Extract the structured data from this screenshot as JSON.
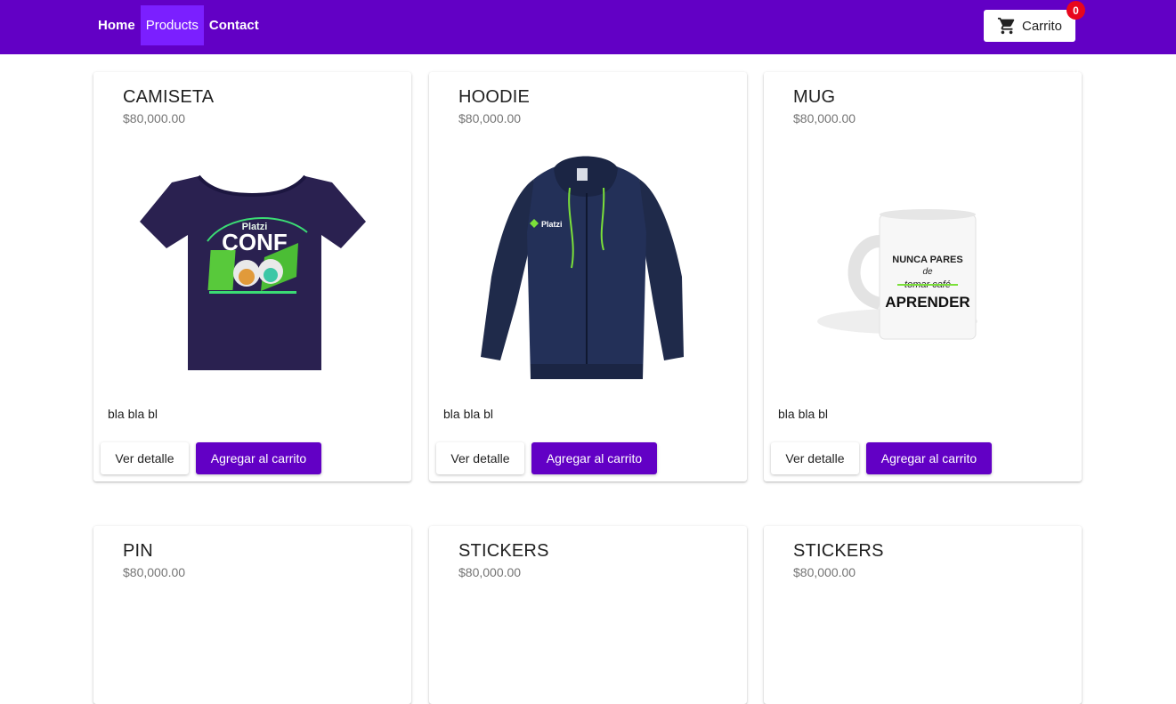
{
  "nav": {
    "items": [
      {
        "label": "Home"
      },
      {
        "label": "Products"
      },
      {
        "label": "Contact"
      }
    ],
    "active": "Products"
  },
  "cart": {
    "label": "Carrito",
    "icon": "shopping-cart-icon",
    "count": "0"
  },
  "colors": {
    "brand": "#6200c5",
    "active_nav": "#7b1fff",
    "badge": "#e8061d"
  },
  "products": [
    {
      "name": "CAMISETA",
      "price": "$80,000.00",
      "description": "bla bla bl",
      "image": "tshirt-image",
      "detail_label": "Ver detalle",
      "add_label": "Agregar al carrito"
    },
    {
      "name": "HOODIE",
      "price": "$80,000.00",
      "description": "bla bla bl",
      "image": "hoodie-image",
      "detail_label": "Ver detalle",
      "add_label": "Agregar al carrito"
    },
    {
      "name": "MUG",
      "price": "$80,000.00",
      "description": "bla bla bl",
      "image": "mug-image",
      "detail_label": "Ver detalle",
      "add_label": "Agregar al carrito"
    },
    {
      "name": "PIN",
      "price": "$80,000.00"
    },
    {
      "name": "STICKERS",
      "price": "$80,000.00"
    },
    {
      "name": "STICKERS",
      "price": "$80,000.00"
    }
  ],
  "images": {
    "tshirt": {
      "logo_text": "Platzi",
      "print_text": "CONF"
    },
    "hoodie": {
      "logo_text": "Platzi"
    },
    "mug": {
      "line1": "NUNCA PARES",
      "line2": "de",
      "line3": "tomar café",
      "line4": "APRENDER"
    }
  }
}
